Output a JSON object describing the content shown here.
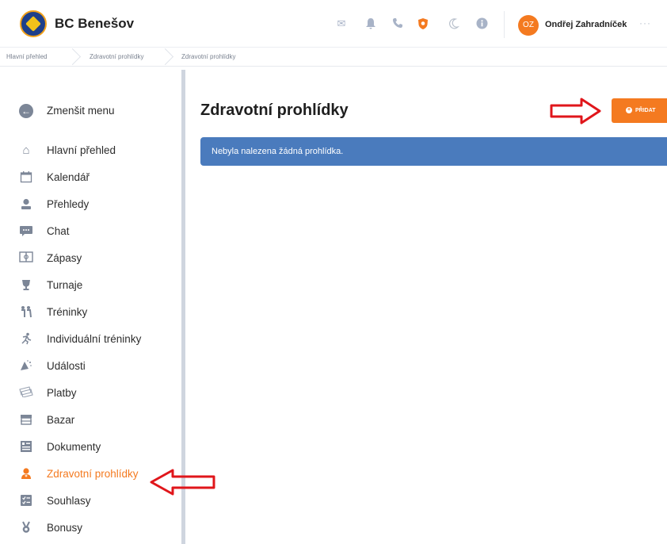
{
  "header": {
    "brand": "BC Benešov",
    "icons": [
      "mail-icon",
      "bell-icon",
      "phone-icon",
      "shield-icon",
      "moon-icon",
      "info-icon"
    ],
    "user_initials": "OZ",
    "user_name": "Ondřej Zahradníček",
    "more": "···"
  },
  "breadcrumb": [
    "Hlavní přehled",
    "Zdravotní prohlídky",
    "Zdravotní prohlídky"
  ],
  "sidebar": {
    "collapse_label": "Zmenšit menu",
    "items": [
      {
        "label": "Hlavní přehled",
        "icon": "home-icon"
      },
      {
        "label": "Kalendář",
        "icon": "calendar-icon"
      },
      {
        "label": "Přehledy",
        "icon": "user-overview-icon"
      },
      {
        "label": "Chat",
        "icon": "chat-icon"
      },
      {
        "label": "Zápasy",
        "icon": "match-icon"
      },
      {
        "label": "Turnaje",
        "icon": "trophy-icon"
      },
      {
        "label": "Tréninky",
        "icon": "training-icon"
      },
      {
        "label": "Individuální tréninky",
        "icon": "running-icon"
      },
      {
        "label": "Události",
        "icon": "events-icon"
      },
      {
        "label": "Platby",
        "icon": "payments-icon"
      },
      {
        "label": "Bazar",
        "icon": "store-icon"
      },
      {
        "label": "Dokumenty",
        "icon": "documents-icon"
      },
      {
        "label": "Zdravotní prohlídky",
        "icon": "doctor-icon",
        "active": true
      },
      {
        "label": "Souhlasy",
        "icon": "consent-icon"
      },
      {
        "label": "Bonusy",
        "icon": "medal-icon"
      }
    ]
  },
  "main": {
    "title": "Zdravotní prohlídky",
    "add_button": "PŘIDAT",
    "alert": "Nebyla nalezena žádná prohlídka."
  },
  "colors": {
    "accent": "#f47a20",
    "alert": "#4a7bbd",
    "annotation": "#e0161b"
  }
}
